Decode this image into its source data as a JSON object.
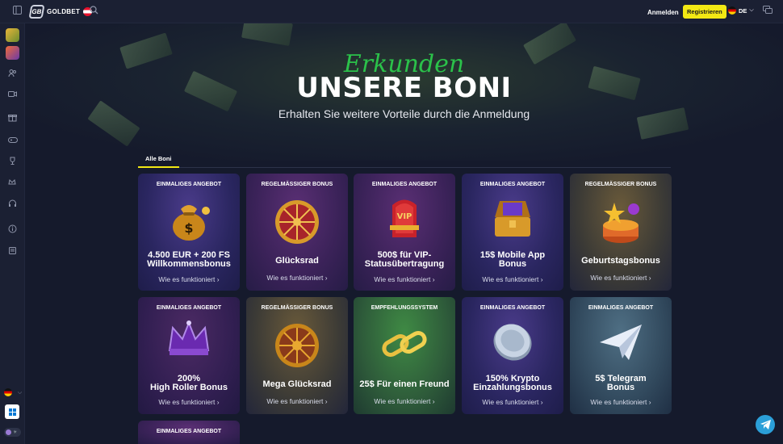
{
  "header": {
    "brand": "GOLDBET",
    "logo_mark": "GB",
    "login_label": "Anmelden",
    "register_label": "Registrieren",
    "language": "DE",
    "icons": [
      "sidebar-toggle-icon",
      "search-icon",
      "chevron-down-icon",
      "chat-icon"
    ]
  },
  "sidebar": {
    "icons": [
      "slots-game-icon",
      "sports-game-icon",
      "user-group-icon",
      "video-icon",
      "gift-icon",
      "gamepad-icon",
      "trophy-icon",
      "crown-icon",
      "headset-icon",
      "info-icon",
      "document-icon"
    ]
  },
  "hero": {
    "script": "Erkunden",
    "title": "UNSERE BONI",
    "subtitle": "Erhalten Sie weitere Vorteile durch die Anmeldung"
  },
  "tabs": [
    {
      "label": "Alle Boni"
    }
  ],
  "cards": [
    {
      "tag": "EINMALIGES ANGEBOT",
      "name_l1": "4.500 EUR + 200 FS",
      "name_l2": "Willkommensbonus",
      "link": "Wie es funktioniert",
      "icon": "money-bag-icon"
    },
    {
      "tag": "REGELMÄSSIGER BONUS",
      "name_l1": "Glücksrad",
      "name_l2": "",
      "link": "Wie es funktioniert",
      "icon": "fortune-wheel-icon"
    },
    {
      "tag": "EINMALIGES ANGEBOT",
      "name_l1": "500$ für VIP-",
      "name_l2": "Statusübertragung",
      "link": "Wie es funktioniert",
      "icon": "vip-throne-icon"
    },
    {
      "tag": "EINMALIGES ANGEBOT",
      "name_l1": "15$ Mobile App",
      "name_l2": "Bonus",
      "link": "Wie es funktioniert",
      "icon": "treasure-chest-icon"
    },
    {
      "tag": "REGELMÄSSIGER BONUS",
      "name_l1": "Geburtstagsbonus",
      "name_l2": "",
      "link": "Wie es funktioniert",
      "icon": "birthday-cake-icon"
    },
    {
      "tag": "EINMALIGES ANGEBOT",
      "name_l1": "200%",
      "name_l2": "High Roller Bonus",
      "link": "Wie es funktioniert",
      "icon": "crown-icon"
    },
    {
      "tag": "REGELMÄSSIGER BONUS",
      "name_l1": "Mega Glücksrad",
      "name_l2": "",
      "link": "Wie es funktioniert",
      "icon": "mega-wheel-icon"
    },
    {
      "tag": "EMPFEHLUNGSSYSTEM",
      "name_l1": "25$ Für einen Freund",
      "name_l2": "",
      "link": "Wie es funktioniert",
      "icon": "chain-link-icon"
    },
    {
      "tag": "EINMALIGES ANGEBOT",
      "name_l1": "150% Krypto",
      "name_l2": "Einzahlungsbonus",
      "link": "Wie es funktioniert",
      "icon": "crypto-coin-icon"
    },
    {
      "tag": "EINMALIGES ANGEBOT",
      "name_l1": "5$ Telegram",
      "name_l2": "Bonus",
      "link": "Wie es funktioniert",
      "icon": "paper-plane-icon"
    },
    {
      "tag": "EINMALIGES ANGEBOT",
      "name_l1": "",
      "name_l2": "",
      "link": "",
      "icon": ""
    }
  ],
  "colors": {
    "accent_yellow": "#f2e814",
    "hero_script_green": "#2bc24a",
    "page_bg": "#151a2c",
    "telegram_blue": "#2b9fd8"
  }
}
